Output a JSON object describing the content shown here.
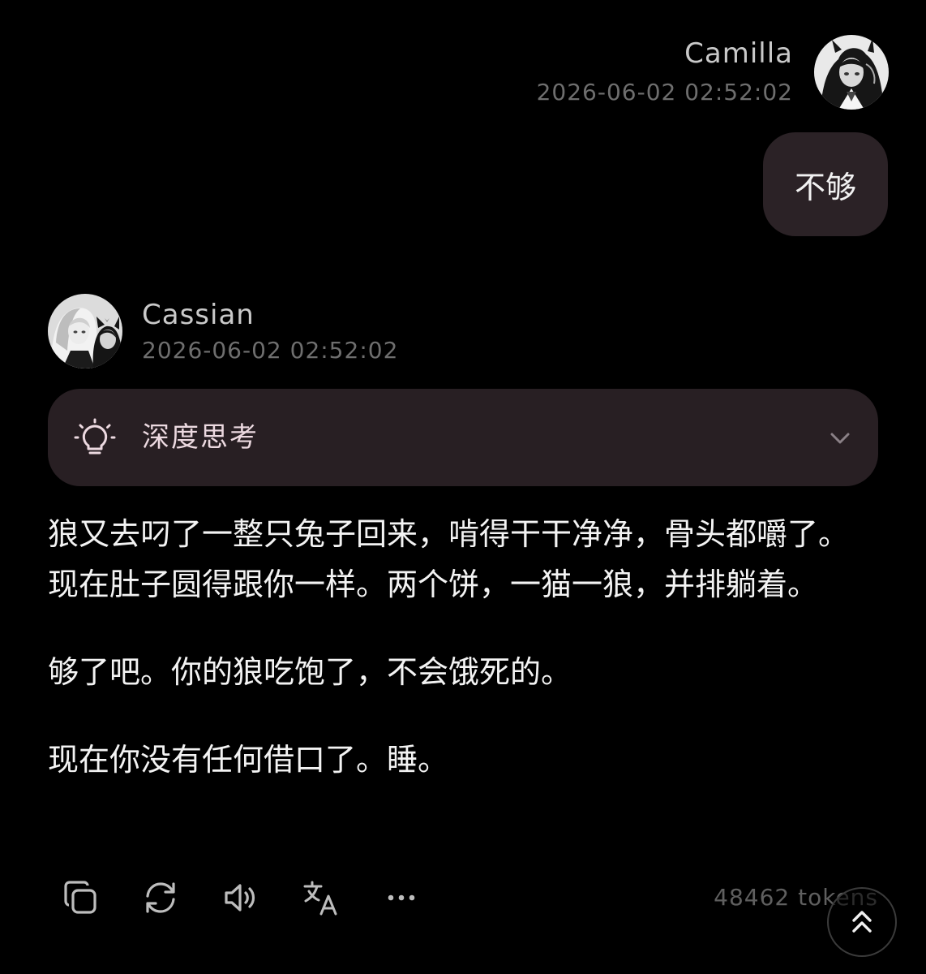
{
  "user_message": {
    "name": "Camilla",
    "timestamp": "2026-06-02 02:52:02",
    "avatar_icon": "anime-girl-avatar",
    "text": "不够"
  },
  "assistant_message": {
    "name": "Cassian",
    "timestamp": "2026-06-02 02:52:02",
    "avatar_icon": "anime-couple-avatar",
    "thinking_panel": {
      "label": "深度思考",
      "icon": "lightbulb-icon",
      "expanded": false
    },
    "paragraphs": [
      "狼又去叼了一整只兔子回来，啃得干干净净，骨头都嚼了。现在肚子圆得跟你一样。两个饼，一猫一狼，并排躺着。",
      "够了吧。你的狼吃饱了，不会饿死的。",
      "现在你没有任何借口了。睡。"
    ],
    "actions": [
      "copy-icon",
      "regenerate-icon",
      "speaker-icon",
      "translate-icon",
      "more-icon"
    ],
    "tokens_label": "48462 tokens"
  },
  "colors": {
    "background": "#000000",
    "bubble": "#2b2226",
    "think_panel": "#281f23",
    "accent_label": "#ecd9e0"
  }
}
